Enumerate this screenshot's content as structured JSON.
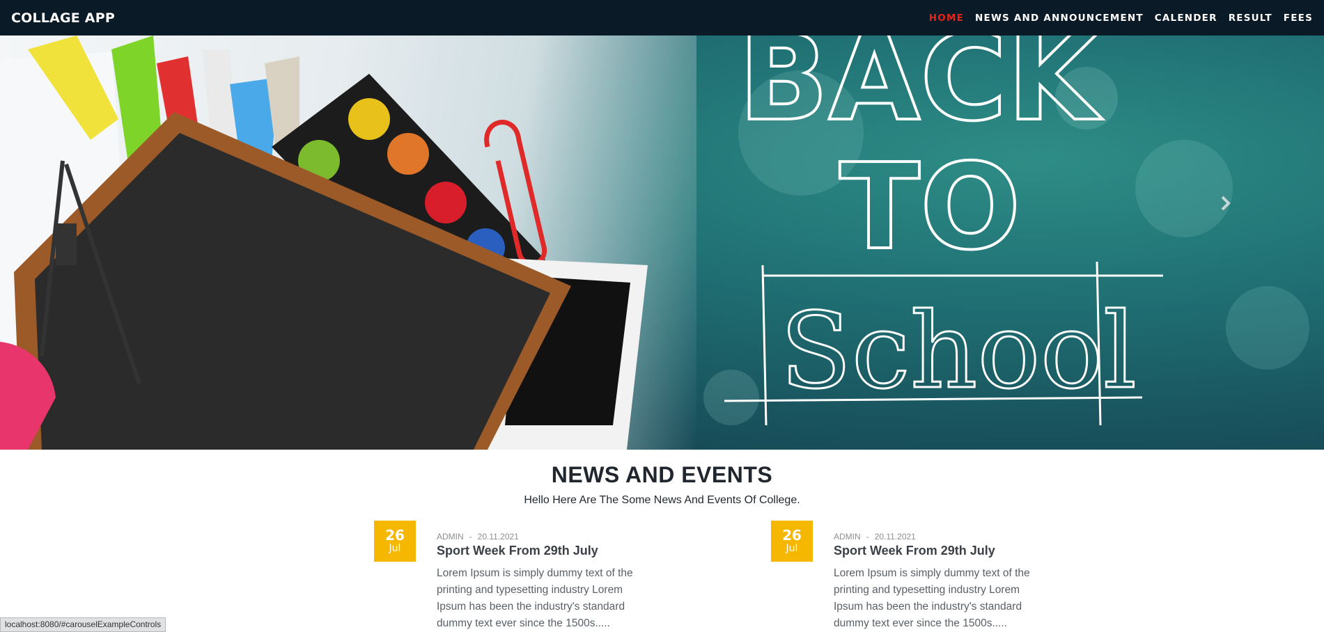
{
  "navbar": {
    "brand": "COLLAGE APP",
    "links": [
      {
        "label": "HOME",
        "active": true
      },
      {
        "label": "NEWS AND ANNOUNCEMENT",
        "active": false
      },
      {
        "label": "CALENDER",
        "active": false
      },
      {
        "label": "RESULT",
        "active": false
      },
      {
        "label": "FEES",
        "active": false
      }
    ],
    "active_color": "#e5231b",
    "background": "#0a1a26"
  },
  "hero": {
    "chalk_text_line1": "BACK",
    "chalk_text_line2": "TO",
    "chalk_text_line3": "School",
    "next_control_icon": "chevron-right-icon"
  },
  "news_section": {
    "title": "NEWS AND EVENTS",
    "subtitle": "Hello Here Are The Some News And Events Of College.",
    "items": [
      {
        "day": "26",
        "month": "Jul",
        "author": "ADMIN",
        "date": "20.11.2021",
        "title": "Sport Week From 29th July",
        "body": "Lorem Ipsum is simply dummy text of the printing and typesetting industry Lorem Ipsum has been the industry's standard dummy text ever since the 1500s....."
      },
      {
        "day": "26",
        "month": "Jul",
        "author": "ADMIN",
        "date": "20.11.2021",
        "title": "Sport Week From 29th July",
        "body": "Lorem Ipsum is simply dummy text of the printing and typesetting industry Lorem Ipsum has been the industry's standard dummy text ever since the 1500s....."
      }
    ],
    "date_box_color": "#f5b700"
  },
  "statusbar": {
    "url": "localhost:8080/#carouselExampleControls"
  }
}
